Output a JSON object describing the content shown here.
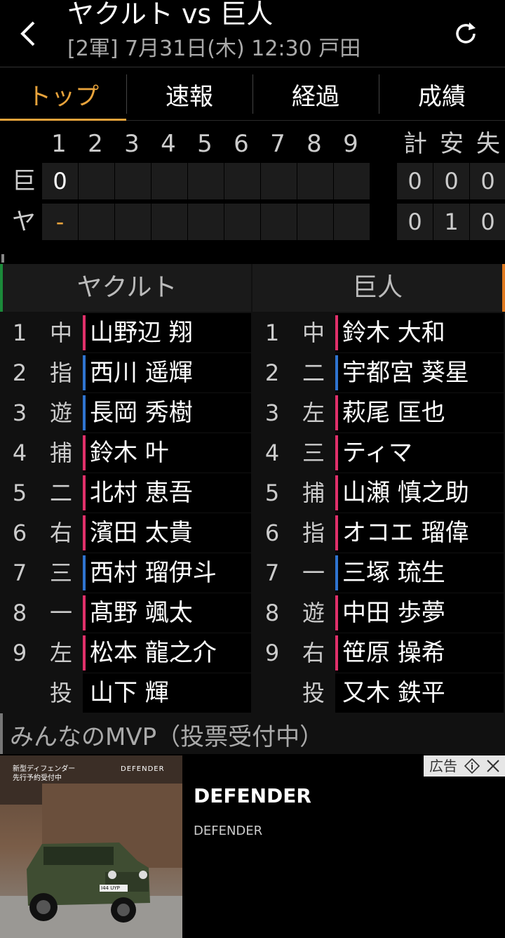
{
  "header": {
    "title": "ヤクルト vs 巨人",
    "subtitle": "[2軍] 7月31日(木) 12:30 戸田",
    "back_icon": "back-chevron-icon",
    "refresh_icon": "refresh-icon"
  },
  "tabs": [
    {
      "label": "トップ",
      "active": true
    },
    {
      "label": "速報",
      "active": false
    },
    {
      "label": "経過",
      "active": false
    },
    {
      "label": "成績",
      "active": false
    }
  ],
  "scoreboard": {
    "innings": [
      "1",
      "2",
      "3",
      "4",
      "5",
      "6",
      "7",
      "8",
      "9"
    ],
    "totals_headers": [
      "計",
      "安",
      "失"
    ],
    "rows": [
      {
        "team": "巨",
        "innings": [
          "0",
          "",
          "",
          "",
          "",
          "",
          "",
          "",
          ""
        ],
        "totals": [
          "0",
          "0",
          "0"
        ],
        "first_color": "#ffffff"
      },
      {
        "team": "ヤ",
        "innings": [
          "-",
          "",
          "",
          "",
          "",
          "",
          "",
          "",
          ""
        ],
        "totals": [
          "0",
          "1",
          "0"
        ],
        "first_color": "#e8a33b"
      }
    ]
  },
  "lineup": {
    "left_team": "ヤクルト",
    "right_team": "巨人",
    "left_color": "#1b8a3a",
    "right_color": "#e07a1f",
    "left": [
      {
        "order": "1",
        "pos": "中",
        "name": "山野辺 翔",
        "bat": "R"
      },
      {
        "order": "2",
        "pos": "指",
        "name": "西川 遥輝",
        "bat": "L"
      },
      {
        "order": "3",
        "pos": "遊",
        "name": "長岡 秀樹",
        "bat": "L"
      },
      {
        "order": "4",
        "pos": "捕",
        "name": "鈴木 叶",
        "bat": "R"
      },
      {
        "order": "5",
        "pos": "二",
        "name": "北村 恵吾",
        "bat": "R"
      },
      {
        "order": "6",
        "pos": "右",
        "name": "濱田 太貴",
        "bat": "R"
      },
      {
        "order": "7",
        "pos": "三",
        "name": "西村 瑠伊斗",
        "bat": "L"
      },
      {
        "order": "8",
        "pos": "一",
        "name": "髙野 颯太",
        "bat": "R"
      },
      {
        "order": "9",
        "pos": "左",
        "name": "松本 龍之介",
        "bat": "R"
      },
      {
        "order": "",
        "pos": "投",
        "name": "山下 輝",
        "bat": "none"
      }
    ],
    "right": [
      {
        "order": "1",
        "pos": "中",
        "name": "鈴木 大和",
        "bat": "R"
      },
      {
        "order": "2",
        "pos": "二",
        "name": "宇都宮 葵星",
        "bat": "L"
      },
      {
        "order": "3",
        "pos": "左",
        "name": "萩尾 匡也",
        "bat": "R"
      },
      {
        "order": "4",
        "pos": "三",
        "name": "ティマ",
        "bat": "R"
      },
      {
        "order": "5",
        "pos": "捕",
        "name": "山瀬 慎之助",
        "bat": "R"
      },
      {
        "order": "6",
        "pos": "指",
        "name": "オコエ 瑠偉",
        "bat": "R"
      },
      {
        "order": "7",
        "pos": "一",
        "name": "三塚 琉生",
        "bat": "L"
      },
      {
        "order": "8",
        "pos": "遊",
        "name": "中田 歩夢",
        "bat": "R"
      },
      {
        "order": "9",
        "pos": "右",
        "name": "笹原 操希",
        "bat": "R"
      },
      {
        "order": "",
        "pos": "投",
        "name": "又木 鉄平",
        "bat": "none"
      }
    ],
    "bat_colors": {
      "R": "#e0306a",
      "L": "#2f74d0",
      "none": "#000000"
    }
  },
  "mvp": {
    "label": "みんなのMVP（投票受付中）"
  },
  "ad": {
    "title": "DEFENDER",
    "subtitle": "DEFENDER",
    "badge": "広告",
    "image_text_1": "新型ディフェンダー",
    "image_text_2": "先行予約受付中",
    "image_brand": "DEFENDER",
    "plate": "I44 UYP"
  }
}
